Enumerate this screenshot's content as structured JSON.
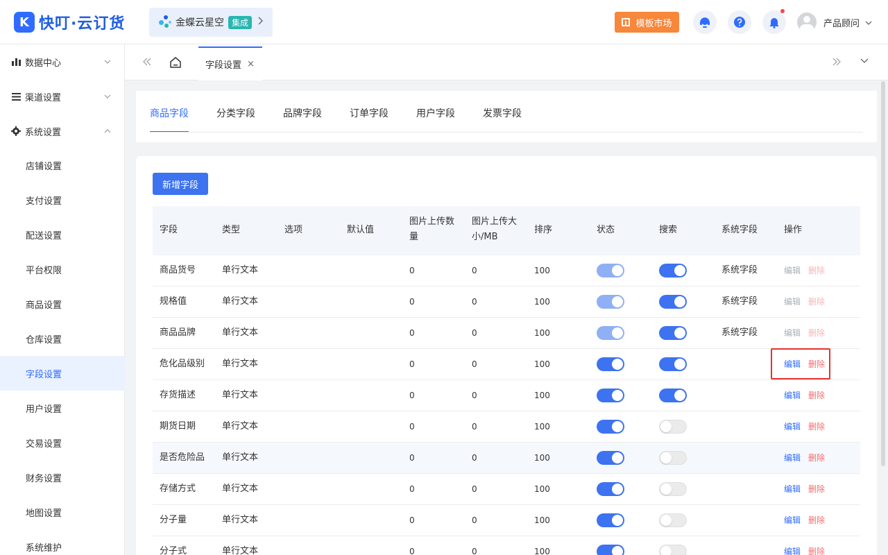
{
  "app": {
    "logo_mark": "K",
    "logo_text": "快叮·云订货",
    "kingdee_text": "金蝶云星空",
    "kingdee_badge": "集成",
    "market_label": "模板市场",
    "user_name": "产品顾问"
  },
  "sidebar": {
    "groups": [
      {
        "label": "数据中心",
        "icon": "bar-chart-icon",
        "expanded": false
      },
      {
        "label": "渠道设置",
        "icon": "list-icon",
        "expanded": false
      },
      {
        "label": "系统设置",
        "icon": "gear-icon",
        "expanded": true
      }
    ],
    "items": [
      {
        "label": "店铺设置",
        "active": false
      },
      {
        "label": "支付设置",
        "active": false
      },
      {
        "label": "配送设置",
        "active": false
      },
      {
        "label": "平台权限",
        "active": false
      },
      {
        "label": "商品设置",
        "active": false
      },
      {
        "label": "仓库设置",
        "active": false
      },
      {
        "label": "字段设置",
        "active": true
      },
      {
        "label": "用户设置",
        "active": false
      },
      {
        "label": "交易设置",
        "active": false
      },
      {
        "label": "财务设置",
        "active": false
      },
      {
        "label": "地图设置",
        "active": false
      },
      {
        "label": "系统维护",
        "active": false
      }
    ]
  },
  "tabbar": {
    "tab_label": "字段设置",
    "close_glyph": "×"
  },
  "subtabs": [
    {
      "label": "商品字段",
      "active": true
    },
    {
      "label": "分类字段",
      "active": false
    },
    {
      "label": "品牌字段",
      "active": false
    },
    {
      "label": "订单字段",
      "active": false
    },
    {
      "label": "用户字段",
      "active": false
    },
    {
      "label": "发票字段",
      "active": false
    }
  ],
  "add_button": "新增字段",
  "table": {
    "headers": {
      "field": "字段",
      "type": "类型",
      "options": "选项",
      "default": "默认值",
      "img_count_1": "图片上传数",
      "img_count_2": "量",
      "img_size_1": "图片上传大",
      "img_size_2": "小/MB",
      "sort": "排序",
      "status": "状态",
      "search": "搜索",
      "system": "系统字段",
      "action": "操作"
    },
    "edit_label": "编辑",
    "delete_label": "删除",
    "rows": [
      {
        "field": "商品货号",
        "type": "单行文本",
        "img_count": "0",
        "img_size": "0",
        "sort": "100",
        "status": "dim",
        "search": "on",
        "system": "系统字段",
        "ops": "disabled"
      },
      {
        "field": "规格值",
        "type": "单行文本",
        "img_count": "0",
        "img_size": "0",
        "sort": "100",
        "status": "dim",
        "search": "on",
        "system": "系统字段",
        "ops": "disabled"
      },
      {
        "field": "商品品牌",
        "type": "单行文本",
        "img_count": "0",
        "img_size": "0",
        "sort": "100",
        "status": "dim",
        "search": "on",
        "system": "系统字段",
        "ops": "disabled"
      },
      {
        "field": "危化品级别",
        "type": "单行文本",
        "img_count": "0",
        "img_size": "0",
        "sort": "100",
        "status": "on",
        "search": "on",
        "system": "",
        "ops": "active"
      },
      {
        "field": "存货描述",
        "type": "单行文本",
        "img_count": "0",
        "img_size": "0",
        "sort": "100",
        "status": "on",
        "search": "on",
        "system": "",
        "ops": "active"
      },
      {
        "field": "期货日期",
        "type": "单行文本",
        "img_count": "0",
        "img_size": "0",
        "sort": "100",
        "status": "on",
        "search": "off",
        "system": "",
        "ops": "active"
      },
      {
        "field": "是否危险品",
        "type": "单行文本",
        "img_count": "0",
        "img_size": "0",
        "sort": "100",
        "status": "on",
        "search": "off",
        "system": "",
        "ops": "active"
      },
      {
        "field": "存储方式",
        "type": "单行文本",
        "img_count": "0",
        "img_size": "0",
        "sort": "100",
        "status": "on",
        "search": "off",
        "system": "",
        "ops": "active"
      },
      {
        "field": "分子量",
        "type": "单行文本",
        "img_count": "0",
        "img_size": "0",
        "sort": "100",
        "status": "on",
        "search": "off",
        "system": "",
        "ops": "active"
      },
      {
        "field": "分子式",
        "type": "单行文本",
        "img_count": "0",
        "img_size": "0",
        "sort": "100",
        "status": "on",
        "search": "off",
        "system": "",
        "ops": "active"
      }
    ]
  },
  "colors": {
    "primary": "#2f6bff",
    "orange": "#f7873a",
    "danger": "#f56c6c",
    "highlight_box": "#e5312b"
  }
}
